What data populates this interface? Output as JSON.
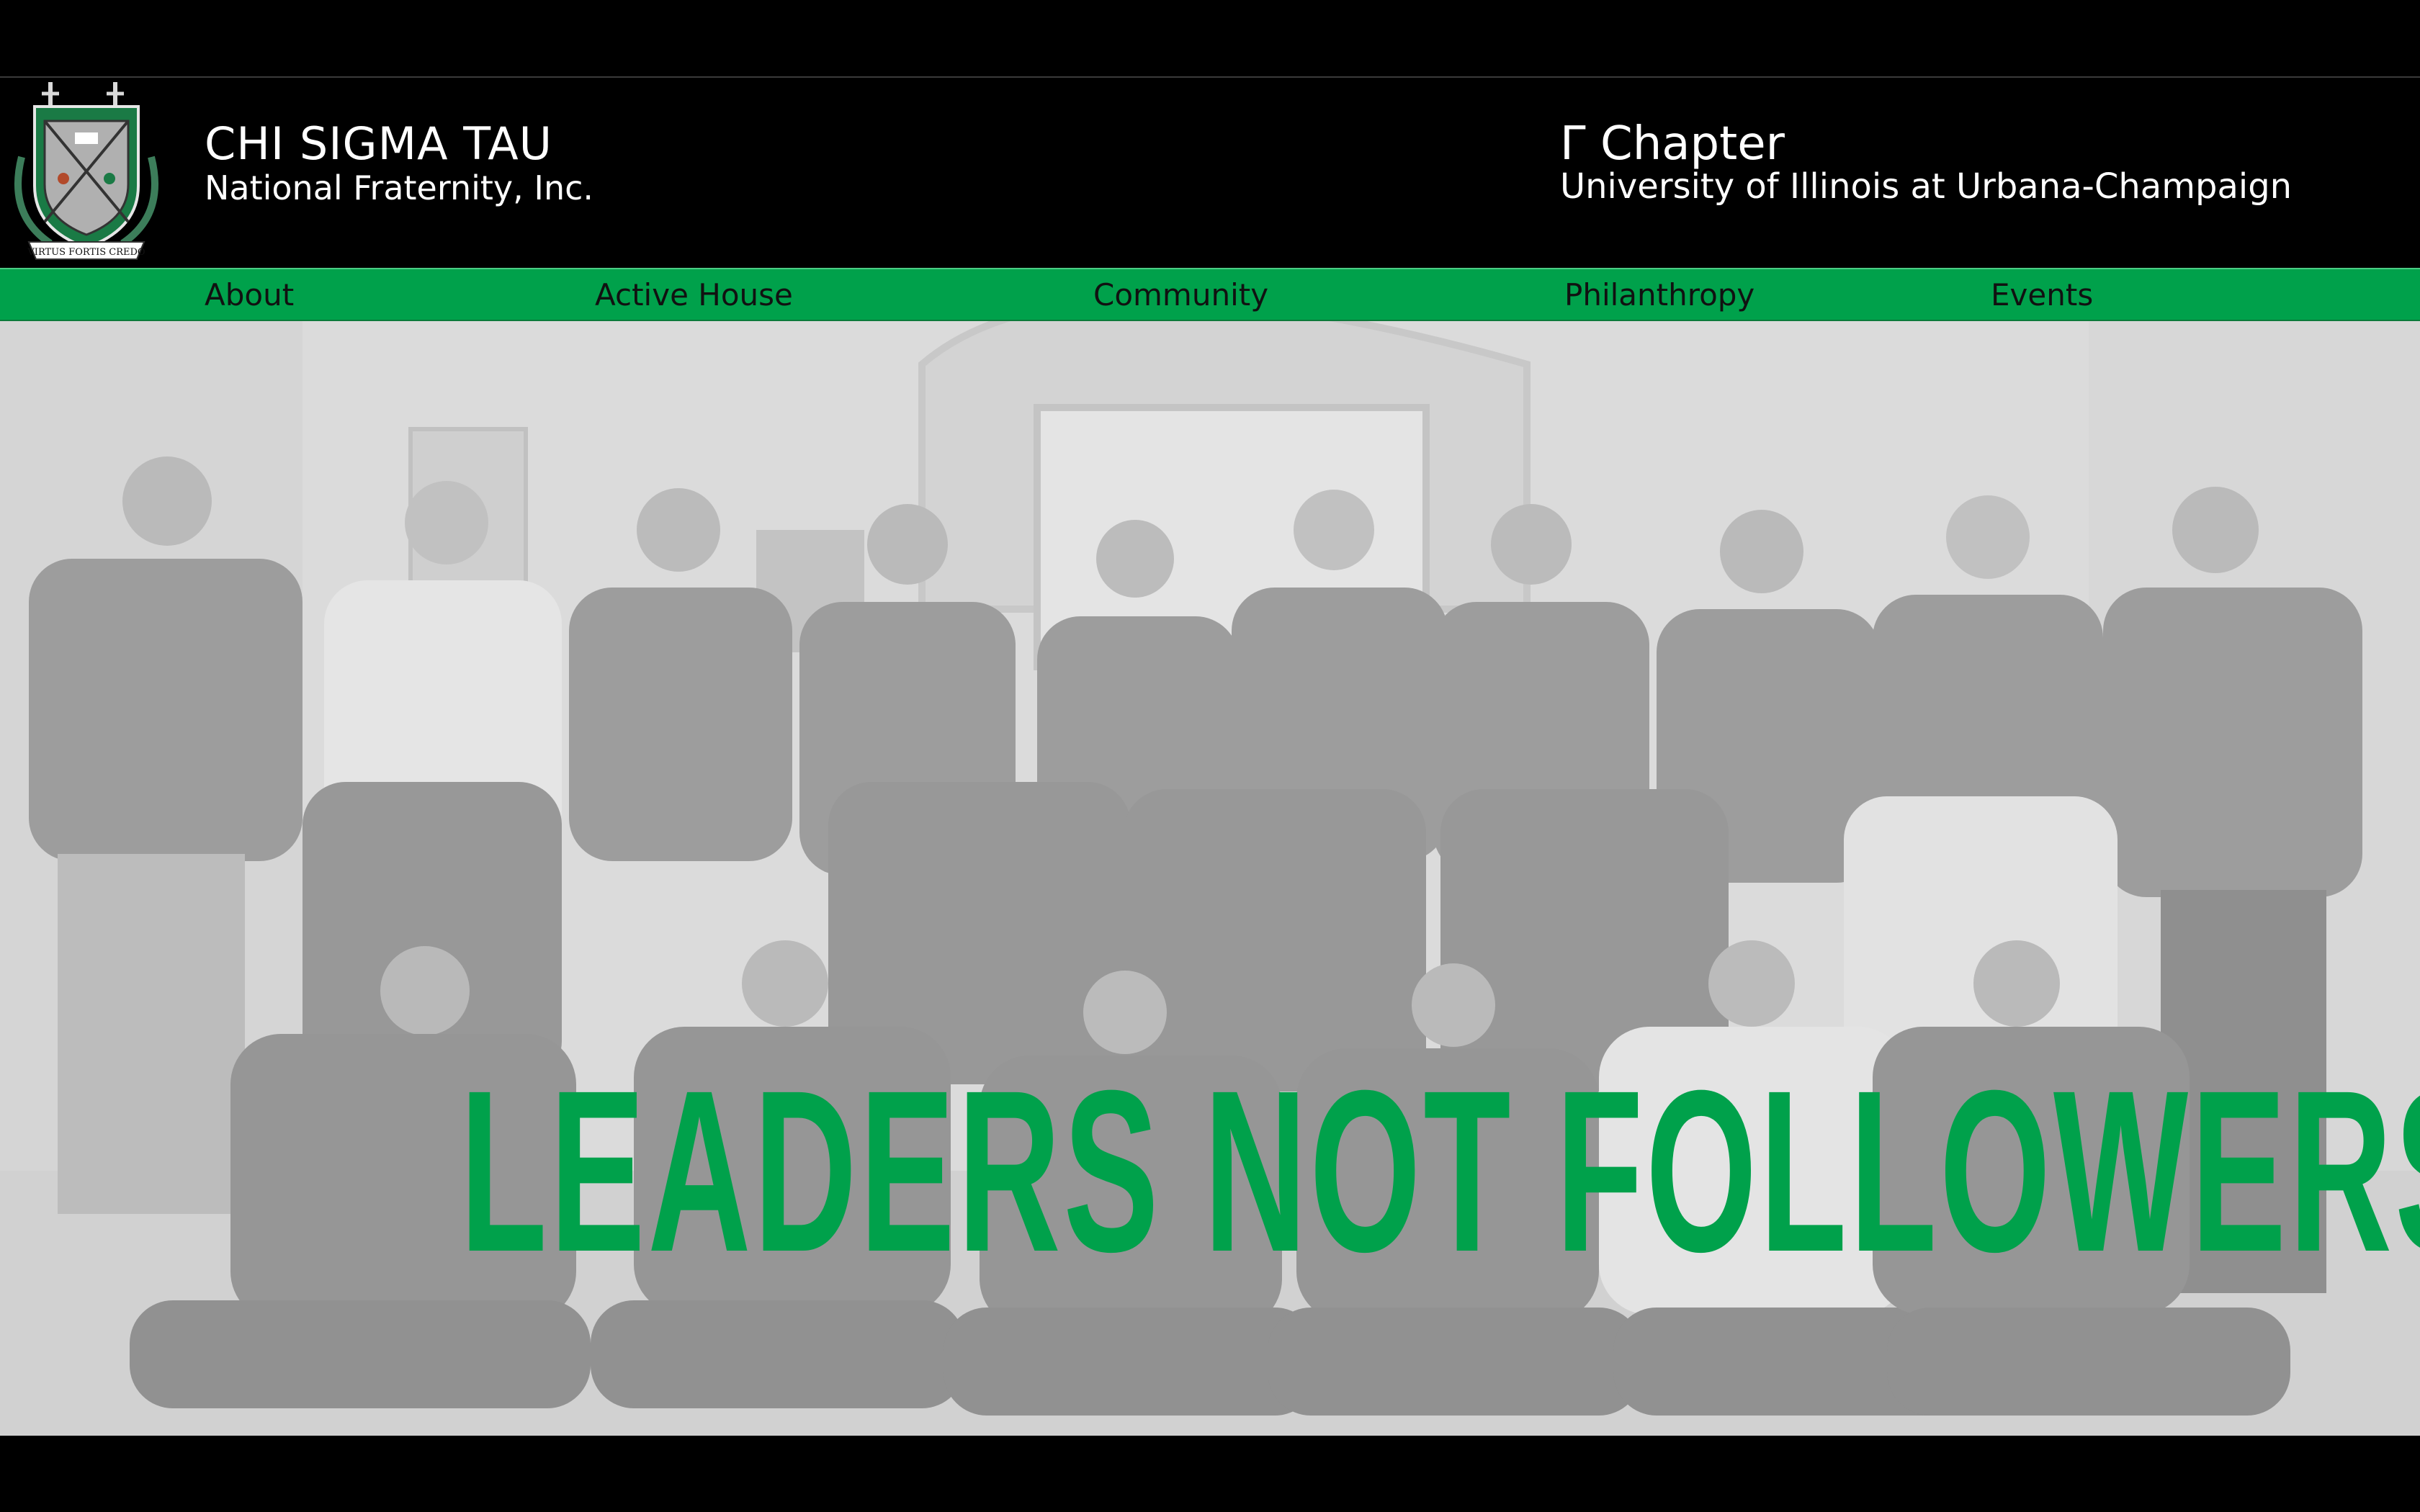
{
  "header": {
    "org_name": "CHI SIGMA TAU",
    "org_subtitle": "National Fraternity, Inc.",
    "chapter_name": "Γ Chapter",
    "chapter_school": "University of Illinois at Urbana-Champaign",
    "crest_icon": "fraternity-crest-icon",
    "crest_motto": "VIRTUS FORTIS CREDO"
  },
  "nav": {
    "items": [
      {
        "label": "About"
      },
      {
        "label": "Active House"
      },
      {
        "label": "Community"
      },
      {
        "label": "Philanthropy"
      },
      {
        "label": "Events"
      }
    ]
  },
  "hero": {
    "slogan": "LEADERS NOT FOLLOWERS",
    "slogan_color": "#00a14b",
    "photo": "group-photo-of-fraternity-members"
  },
  "colors": {
    "accent": "#00a14b",
    "header_bg": "#000000"
  }
}
